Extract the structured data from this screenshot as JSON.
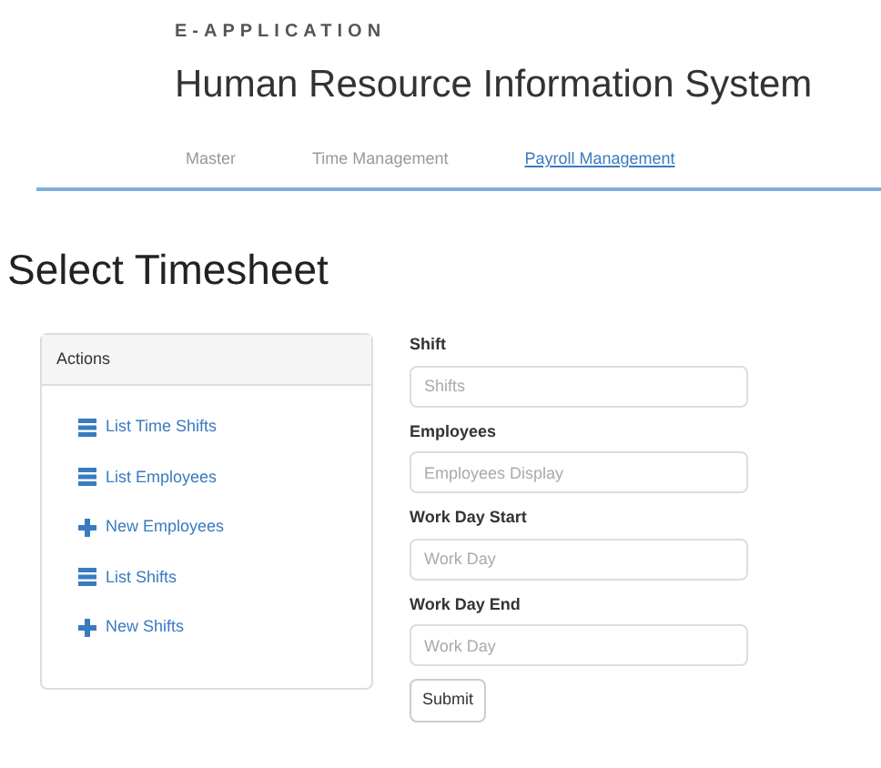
{
  "brand": "E-APPLICATION",
  "app_title": "Human Resource Information System",
  "nav": [
    {
      "label": "Master",
      "selected": false
    },
    {
      "label": "Time Management",
      "selected": false
    },
    {
      "label": "Payroll Management",
      "selected": true
    }
  ],
  "page_title": "Select Timesheet",
  "actions": {
    "title": "Actions",
    "items": [
      {
        "kind": "list",
        "label": "List Time Shifts"
      },
      {
        "kind": "list",
        "label": "List Employees"
      },
      {
        "kind": "new",
        "label": "New Employees"
      },
      {
        "kind": "list",
        "label": "List Shifts"
      },
      {
        "kind": "new",
        "label": "New Shifts"
      }
    ]
  },
  "form": {
    "fields": [
      {
        "label": "Shift",
        "placeholder": "Shifts"
      },
      {
        "label": "Employees",
        "placeholder": "Employees Display"
      },
      {
        "label": "Work Day Start",
        "placeholder": "Work Day"
      },
      {
        "label": "Work Day End",
        "placeholder": "Work Day"
      }
    ],
    "submit": "Submit"
  }
}
